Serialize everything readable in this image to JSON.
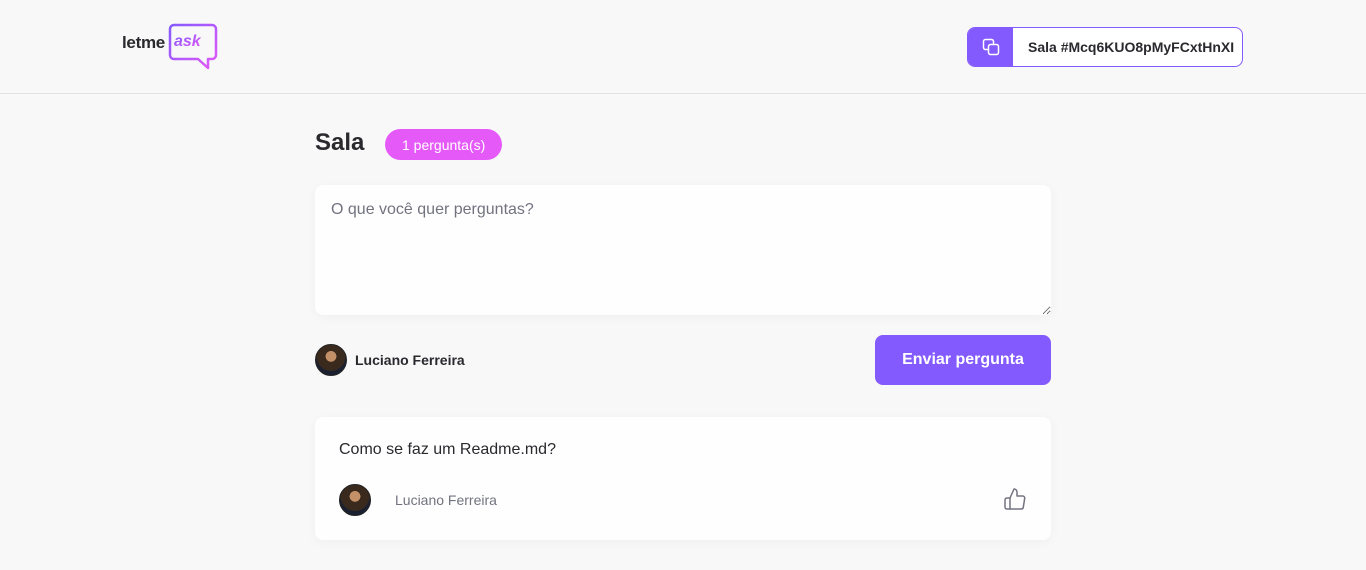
{
  "header": {
    "logo_text": "letme",
    "logo_accent": "ask",
    "room_code_label": "Sala #Mcq6KUO8pMyFCxtHnXI"
  },
  "room": {
    "title": "Sala",
    "question_count": "1 pergunta(s)"
  },
  "form": {
    "placeholder": "O que você quer perguntas?",
    "value": "",
    "user_name": "Luciano Ferreira",
    "submit_label": "Enviar pergunta"
  },
  "questions": [
    {
      "content": "Como se faz um Readme.md?",
      "author": "Luciano Ferreira"
    }
  ],
  "colors": {
    "brand_purple": "#835afd",
    "badge_pink": "#e559f9",
    "background": "#f8f8f8"
  },
  "icons": [
    "copy-icon",
    "like-icon",
    "speech-bubble-logo"
  ]
}
